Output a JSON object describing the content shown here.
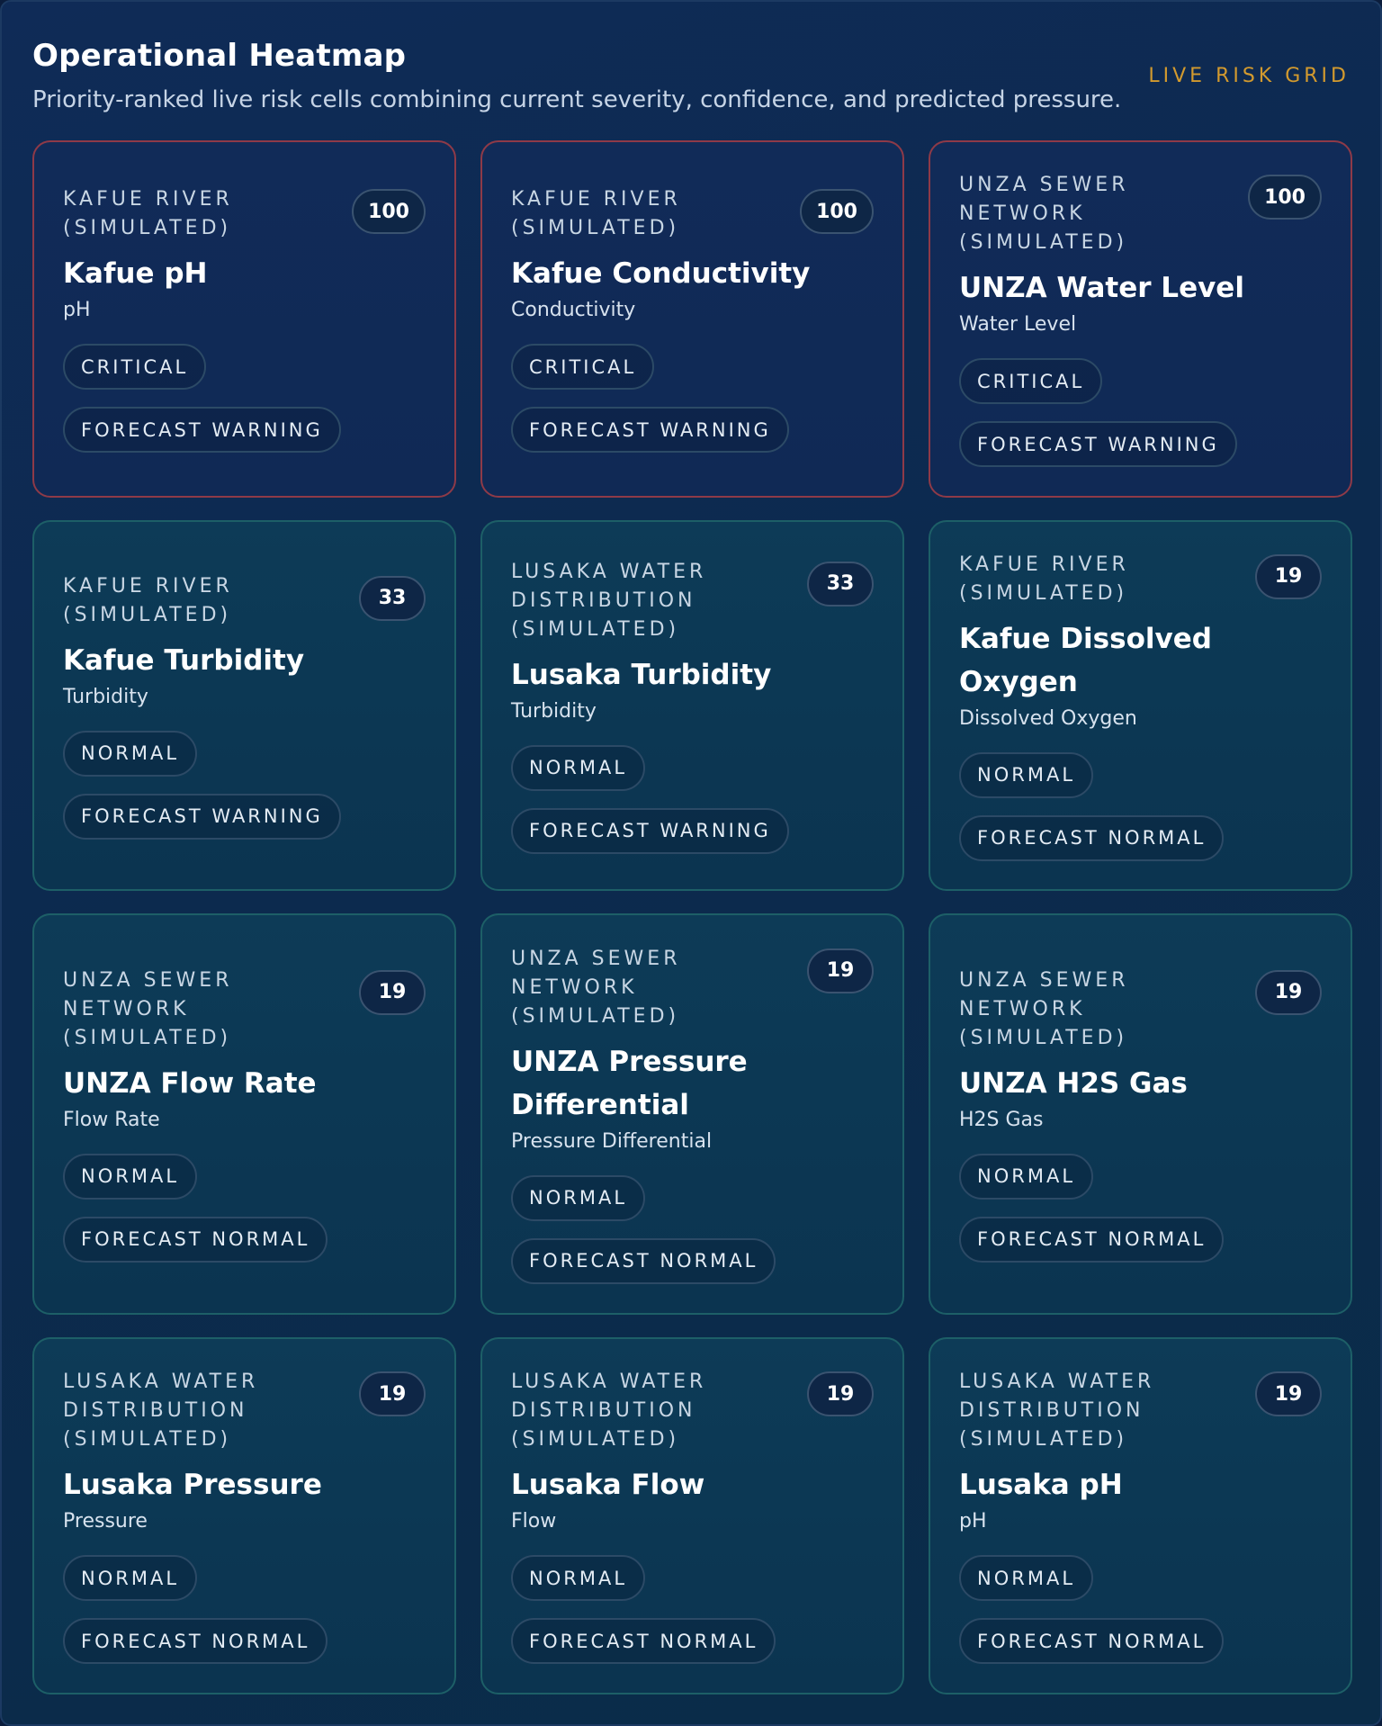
{
  "header": {
    "title": "Operational Heatmap",
    "subtitle": "Priority-ranked live risk cells combining current severity, confidence, and predicted pressure.",
    "tag": "LIVE RISK GRID"
  },
  "cards": [
    {
      "site": "KAFUE RIVER (SIMULATED)",
      "score": "100",
      "name": "Kafue pH",
      "metric": "pH",
      "status": "CRITICAL",
      "forecast": "FORECAST WARNING",
      "level": "critical"
    },
    {
      "site": "KAFUE RIVER (SIMULATED)",
      "score": "100",
      "name": "Kafue Conductivity",
      "metric": "Conductivity",
      "status": "CRITICAL",
      "forecast": "FORECAST WARNING",
      "level": "critical"
    },
    {
      "site": "UNZA SEWER NETWORK (SIMULATED)",
      "score": "100",
      "name": "UNZA Water Level",
      "metric": "Water Level",
      "status": "CRITICAL",
      "forecast": "FORECAST WARNING",
      "level": "critical"
    },
    {
      "site": "KAFUE RIVER (SIMULATED)",
      "score": "33",
      "name": "Kafue Turbidity",
      "metric": "Turbidity",
      "status": "NORMAL",
      "forecast": "FORECAST WARNING",
      "level": "normal"
    },
    {
      "site": "LUSAKA WATER DISTRIBUTION (SIMULATED)",
      "score": "33",
      "name": "Lusaka Turbidity",
      "metric": "Turbidity",
      "status": "NORMAL",
      "forecast": "FORECAST WARNING",
      "level": "normal"
    },
    {
      "site": "KAFUE RIVER (SIMULATED)",
      "score": "19",
      "name": "Kafue Dissolved Oxygen",
      "metric": "Dissolved Oxygen",
      "status": "NORMAL",
      "forecast": "FORECAST NORMAL",
      "level": "normal"
    },
    {
      "site": "UNZA SEWER NETWORK (SIMULATED)",
      "score": "19",
      "name": "UNZA Flow Rate",
      "metric": "Flow Rate",
      "status": "NORMAL",
      "forecast": "FORECAST NORMAL",
      "level": "normal"
    },
    {
      "site": "UNZA SEWER NETWORK (SIMULATED)",
      "score": "19",
      "name": "UNZA Pressure Differential",
      "metric": "Pressure Differential",
      "status": "NORMAL",
      "forecast": "FORECAST NORMAL",
      "level": "normal"
    },
    {
      "site": "UNZA SEWER NETWORK (SIMULATED)",
      "score": "19",
      "name": "UNZA H2S Gas",
      "metric": "H2S Gas",
      "status": "NORMAL",
      "forecast": "FORECAST NORMAL",
      "level": "normal"
    },
    {
      "site": "LUSAKA WATER DISTRIBUTION (SIMULATED)",
      "score": "19",
      "name": "Lusaka Pressure",
      "metric": "Pressure",
      "status": "NORMAL",
      "forecast": "FORECAST NORMAL",
      "level": "normal"
    },
    {
      "site": "LUSAKA WATER DISTRIBUTION (SIMULATED)",
      "score": "19",
      "name": "Lusaka Flow",
      "metric": "Flow",
      "status": "NORMAL",
      "forecast": "FORECAST NORMAL",
      "level": "normal"
    },
    {
      "site": "LUSAKA WATER DISTRIBUTION (SIMULATED)",
      "score": "19",
      "name": "Lusaka pH",
      "metric": "pH",
      "status": "NORMAL",
      "forecast": "FORECAST NORMAL",
      "level": "normal"
    }
  ]
}
